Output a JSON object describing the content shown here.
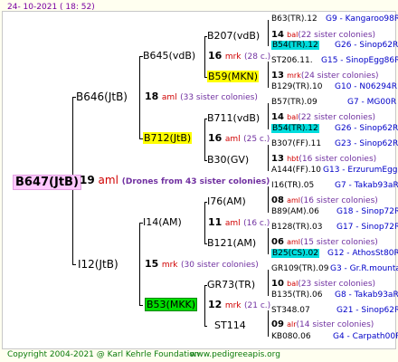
{
  "header": {
    "date": "24- 10-2021 ( 18: 52)"
  },
  "footer": {
    "copyright": "Copyright 2004-2021 @ Karl Kehrle Foundation",
    "site": "www.pedigreeapis.org"
  },
  "root": {
    "name": "B647(JtB)",
    "year": "19",
    "type": "aml",
    "note": "(Drones from 43 sister colonies)"
  },
  "gen1": [
    {
      "name": "B646(JtB)",
      "year": "18",
      "type": "aml",
      "note": "(33 sister colonies)"
    },
    {
      "name": "I12(JtB)",
      "year": "15",
      "type": "mrk",
      "note": "(30 sister colonies)"
    }
  ],
  "gen2": [
    {
      "name": "B645(vdB)",
      "year": "16",
      "type": "mrk",
      "note": "(28 c.)"
    },
    {
      "name": "B712(JtB)",
      "year": "16",
      "type": "aml",
      "note": "(25 c.)"
    },
    {
      "name": "I14(AM)",
      "year": "11",
      "type": "aml",
      "note": "(16 c.)"
    },
    {
      "name": "B53(MKK)",
      "year": "12",
      "type": "mrk",
      "note": "(21 c.)"
    }
  ],
  "gen3": [
    {
      "name": "B207(vdB)",
      "year": "14",
      "type": "bal",
      "note": "(22 sister colonies)"
    },
    {
      "name": "B59(MKN)",
      "year": "13",
      "type": "mrk",
      "note": "(24 sister colonies)"
    },
    {
      "name": "B711(vdB)",
      "year": "14",
      "type": "bal",
      "note": "(22 sister colonies)"
    },
    {
      "name": "B30(GV)",
      "year": "13",
      "type": "hbt",
      "note": "(16 sister colonies)"
    },
    {
      "name": "I76(AM)",
      "year": "08",
      "type": "aml",
      "note": "(16 sister colonies)"
    },
    {
      "name": "B121(AM)",
      "year": "06",
      "type": "aml",
      "note": "(15 sister colonies)"
    },
    {
      "name": "GR73(TR)",
      "year": "10",
      "type": "bal",
      "note": "(23 sister colonies)"
    },
    {
      "name": "ST114",
      "year": "09",
      "type": "alr",
      "note": "(14 sister colonies)"
    }
  ],
  "gen4": [
    {
      "name": "B63(TR).12",
      "id": "G9 - Kangaroo98R"
    },
    {
      "name": "B54(TR).12",
      "id": "G26 - Sinop62R"
    },
    {
      "name": "ST206.11.",
      "id": "G15 - SinopEgg86R"
    },
    {
      "name": "B129(TR).10",
      "id": "G10 - N06294R"
    },
    {
      "name": "B57(TR).09",
      "id": "G7 - MG00R"
    },
    {
      "name": "B54(TR).12",
      "id": "G26 - Sinop62R"
    },
    {
      "name": "B307(FF).11",
      "id": "G23 - Sinop62R"
    },
    {
      "name": "A144(FF).10",
      "id": "G13 - ErzurumEgg8"
    },
    {
      "name": "I16(TR).05",
      "id": "G7 - Takab93aR"
    },
    {
      "name": "B89(AM).06",
      "id": "G18 - Sinop72R"
    },
    {
      "name": "B128(TR).03",
      "id": "G17 - Sinop72R"
    },
    {
      "name": "B25(CS).02",
      "id": "G12 - AthosSt80R"
    },
    {
      "name": "GR109(TR).09",
      "id": "G3 - Gr.R.mounta"
    },
    {
      "name": "B135(TR).06",
      "id": "G8 - Takab93aR"
    },
    {
      "name": "ST348.07",
      "id": "G21 - Sinop62R"
    },
    {
      "name": "KB080.06",
      "id": "G4 - Carpath00R"
    }
  ]
}
